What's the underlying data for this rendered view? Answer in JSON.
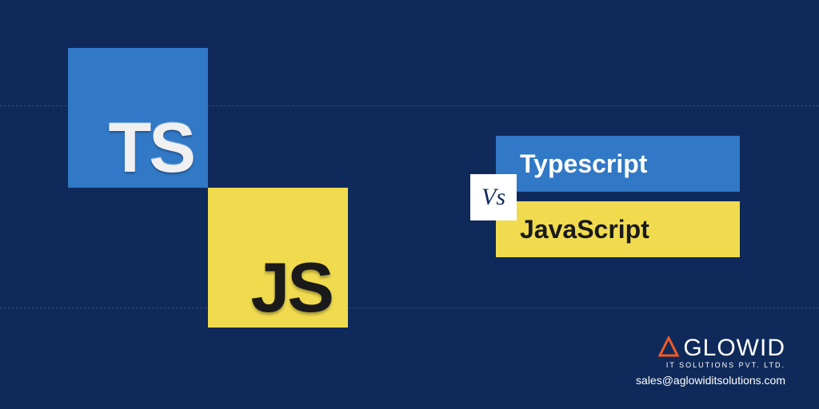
{
  "logos": {
    "ts": "TS",
    "js": "JS"
  },
  "labels": {
    "typescript": "Typescript",
    "javascript": "JavaScript",
    "vs": "Vs"
  },
  "brand": {
    "name": "GLOWID",
    "tagline": "IT SOLUTIONS PVT. LTD.",
    "email": "sales@aglowiditsolutions.com"
  },
  "colors": {
    "background": "#0f2a5a",
    "ts_blue": "#3178c6",
    "js_yellow": "#f0db4f",
    "brand_orange": "#f15a24"
  }
}
